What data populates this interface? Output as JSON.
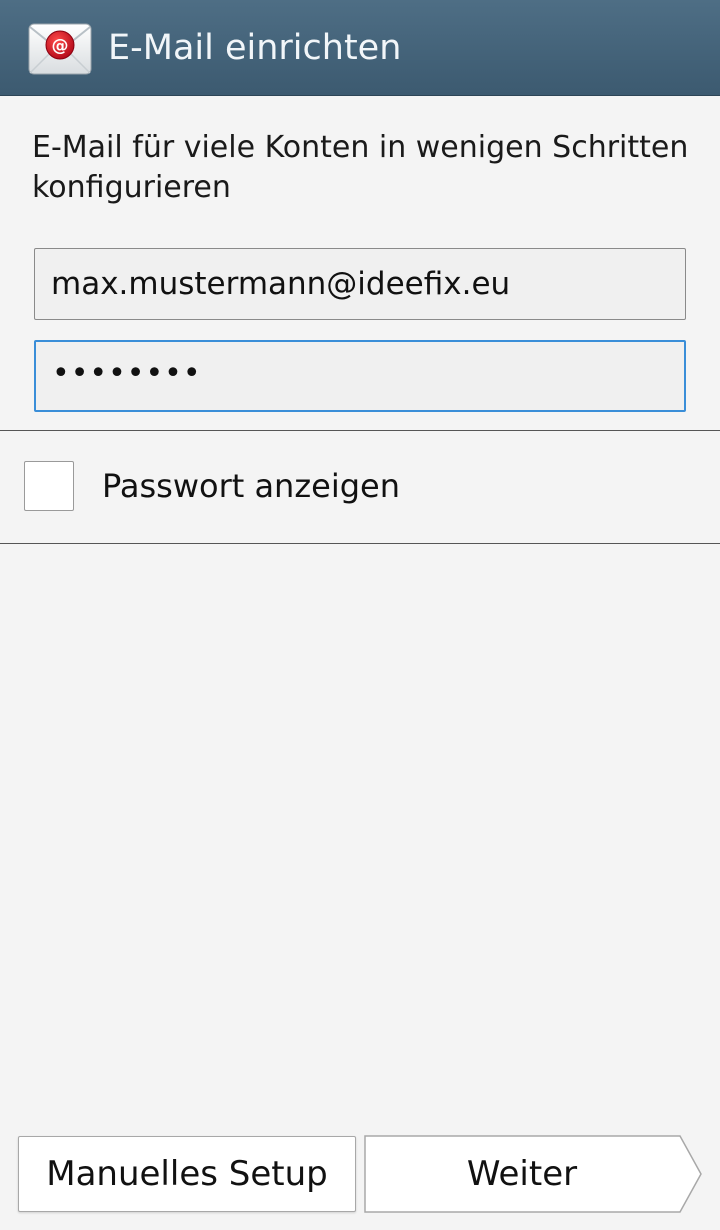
{
  "header": {
    "title": "E-Mail einrichten",
    "icon": "email-at-icon",
    "colors": {
      "bar": "#46657b",
      "icon_red": "#c8102e"
    }
  },
  "intro": {
    "text": "E-Mail für viele Konten in wenigen Schritten konfigurieren"
  },
  "form": {
    "email_value": "max.mustermann@ideefix.eu",
    "password_masked": "••••••••",
    "focus_color": "#3a8ed8"
  },
  "show_password": {
    "label": "Passwort anzeigen",
    "checked": false
  },
  "footer": {
    "manual_setup_label": "Manuelles Setup",
    "next_label": "Weiter"
  }
}
